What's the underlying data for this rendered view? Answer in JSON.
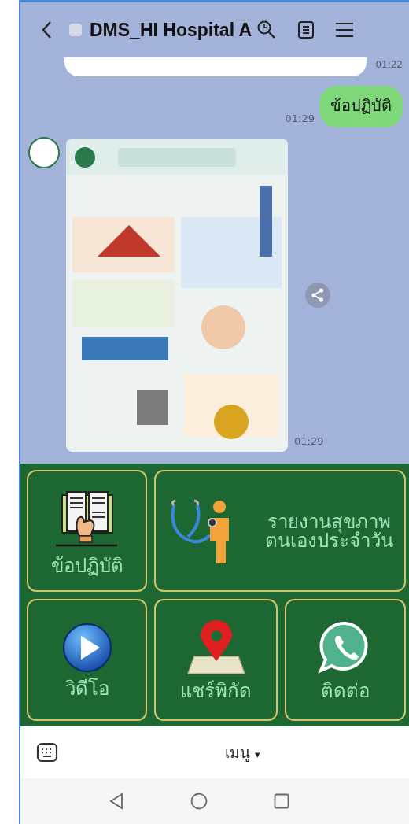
{
  "header": {
    "title": "DMS_HI Hospital A"
  },
  "messages": [
    {
      "kind": "cut",
      "time": "01:22"
    },
    {
      "kind": "outgoing",
      "text": "ข้อปฏิบัติ",
      "time": "01:29"
    },
    {
      "time": "01:29"
    }
  ],
  "rich_menu": {
    "tiles": [
      {
        "kind": "book",
        "label": "ข้อปฏิบัติ"
      },
      {
        "kind": "health",
        "label": "รายงานสุขภาพ\nตนเองประจำวัน"
      },
      {
        "kind": "video",
        "label": "วิดีโอ"
      },
      {
        "kind": "location",
        "label": "แชร์พิกัด"
      },
      {
        "kind": "phone",
        "label": "ติดต่อ"
      }
    ]
  },
  "bottom_bar": {
    "label": "เมนู",
    "caret": "▾"
  }
}
